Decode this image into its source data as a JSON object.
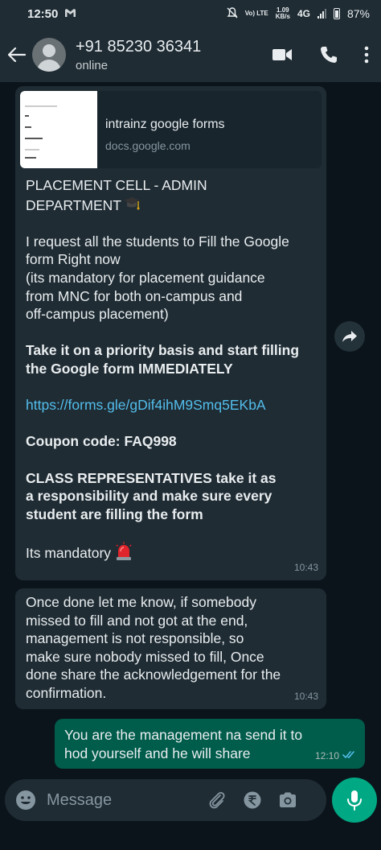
{
  "status_bar": {
    "time": "12:50",
    "notification_icon": "gmail-icon",
    "volte": "Vo) LTE",
    "speed_value": "1.09",
    "speed_unit": "KB/s",
    "network": "4G",
    "battery": "87%"
  },
  "header": {
    "contact_name": "+91 85230 36341",
    "presence": "online",
    "icons": [
      "back-arrow-icon",
      "video-call-icon",
      "phone-call-icon",
      "more-options-icon"
    ]
  },
  "messages": {
    "first": {
      "link_preview": {
        "title": "intrainz google forms",
        "domain": "docs.google.com"
      },
      "line_dept_1": "PLACEMENT CELL - ADMIN",
      "line_dept_2": "DEPARTMENT",
      "request_1": "I request all the students to Fill the Google",
      "request_2": "form Right now",
      "request_3": "(its  mandatory for placement guidance",
      "request_4": "from MNC for both on-campus and",
      "request_5": "off-campus placement)",
      "priority_1": "Take it on a priority basis and start filling",
      "priority_2": "the Google form IMMEDIATELY",
      "link": "https://forms.gle/gDif4ihM9Smq5EKbA",
      "coupon": "Coupon code: FAQ998",
      "class_rep_1": "CLASS REPRESENTATIVES take it as",
      "class_rep_2": "a responsibility and make sure every",
      "class_rep_3": "student are filling the form",
      "mandatory": "Its mandatory",
      "time": "10:43"
    },
    "second": {
      "line_1": "Once done let me know, if somebody",
      "line_2": "missed to fill and not got at the end,",
      "line_3": "management is not responsible, so",
      "line_4": "make sure nobody missed to fill, Once",
      "line_5": "done share the acknowledgement for the",
      "line_6": "confirmation.",
      "time": "10:43"
    },
    "outgoing": {
      "line_1": "You are the management na send it to",
      "line_2": "hod yourself and he will share",
      "time": "12:10",
      "status_icon": "double-check-read-icon"
    }
  },
  "composer": {
    "placeholder": "Message",
    "icons": [
      "emoji-icon",
      "attach-icon",
      "rupee-payment-icon",
      "camera-icon",
      "mic-icon"
    ]
  },
  "colors": {
    "background": "#0b141a",
    "header": "#1f2c34",
    "incoming_bubble": "#1f2c34",
    "outgoing_bubble": "#005c4b",
    "link": "#53bdeb",
    "accent": "#00a884"
  }
}
